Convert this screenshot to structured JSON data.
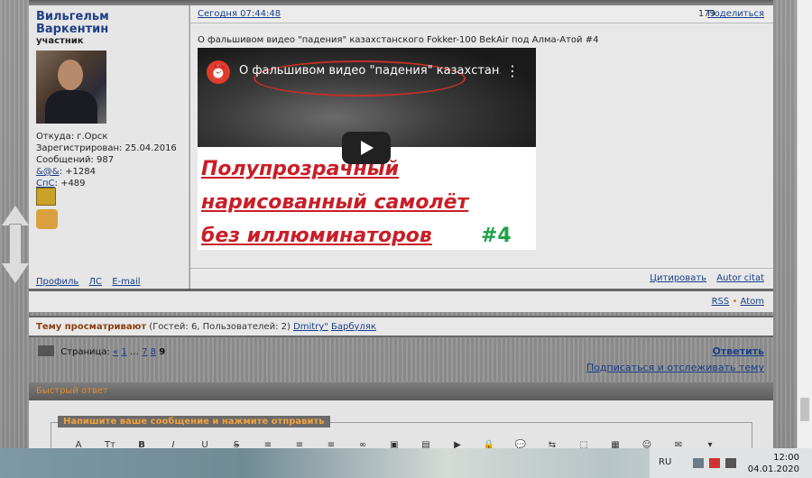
{
  "author": {
    "name": "Вильгельм Варкентин",
    "role": "участник",
    "from": "Откуда: г.Орск",
    "registered": "Зарегистрирован: 25.04.2016",
    "messages": "Сообщений: 987",
    "rep1_label": "&@&",
    "rep1_value": ": +1284",
    "rep2_label": "СпС",
    "rep2_value": ": +489",
    "links": [
      "Профиль",
      "ЛС",
      "E-mail"
    ]
  },
  "post": {
    "date": "Сегодня 07:44:48",
    "views": "179",
    "share": "Поделиться",
    "title": "О фальшивом видео \"падения\" казахстанского Fokker-100 BekAir под Алма-Атой #4",
    "quote": "Цитировать",
    "autor_citat": "Autor citat"
  },
  "video": {
    "title": "О фальшивом видео \"падения\" казахстан...",
    "menu_icon": "more-vert-icon",
    "line1": "Полупрозрачный",
    "line2": "нарисованный самолёт",
    "line3": "без иллюминаторов",
    "num": "#4",
    "red": "#c81e28",
    "green": "#1fa24a"
  },
  "feeds": {
    "rss": "RSS",
    "sep": "•",
    "atom": "Atom"
  },
  "viewing": {
    "label": "Тему просматривают",
    "counts": " (Гостей: 6, Пользователей: 2) ",
    "users": [
      "Dmitry\"",
      "Барбуляк"
    ]
  },
  "pagination": {
    "label": "Страница:",
    "prev": "«",
    "first": "1",
    "ellipsis": "…",
    "p7": "7",
    "p8": "8",
    "current": "9"
  },
  "actions": {
    "reply": "Ответить",
    "subscribe": "Подписаться и отслеживать тему"
  },
  "quick_reply": {
    "title": "Быстрый ответ",
    "legend": "Напишите ваше сообщение и нажмите отправить",
    "tools": [
      "A",
      "Tт",
      "B",
      "I",
      "U",
      "S",
      "≡",
      "≡",
      "≡",
      "∞",
      "▣",
      "▤",
      "▶",
      "🔒",
      "💬",
      "⇆",
      "⬚",
      "▦",
      "☺",
      "✉",
      "▾"
    ]
  },
  "taskbar": {
    "lang": "RU",
    "time": "12:00",
    "date": "04.01.2020"
  }
}
